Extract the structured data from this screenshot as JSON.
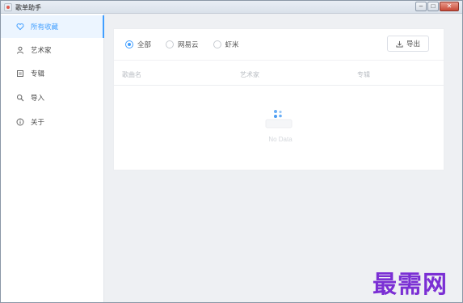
{
  "window": {
    "title": "歌单助手"
  },
  "sidebar": {
    "items": [
      {
        "label": "所有收藏",
        "icon": "heart-icon",
        "active": true
      },
      {
        "label": "艺术家",
        "icon": "user-icon"
      },
      {
        "label": "专辑",
        "icon": "album-icon"
      },
      {
        "label": "导入",
        "icon": "search-icon"
      },
      {
        "label": "关于",
        "icon": "info-icon"
      }
    ]
  },
  "filter": {
    "options": [
      {
        "label": "全部",
        "checked": true
      },
      {
        "label": "网易云",
        "checked": false
      },
      {
        "label": "虾米",
        "checked": false
      }
    ]
  },
  "toolbar": {
    "export_label": "导出"
  },
  "table": {
    "columns": [
      "歌曲名",
      "艺术家",
      "专辑"
    ],
    "empty_text": "No Data"
  },
  "watermark": "最需网",
  "colors": {
    "accent": "#409eff",
    "watermark": "#7b2fd4"
  }
}
